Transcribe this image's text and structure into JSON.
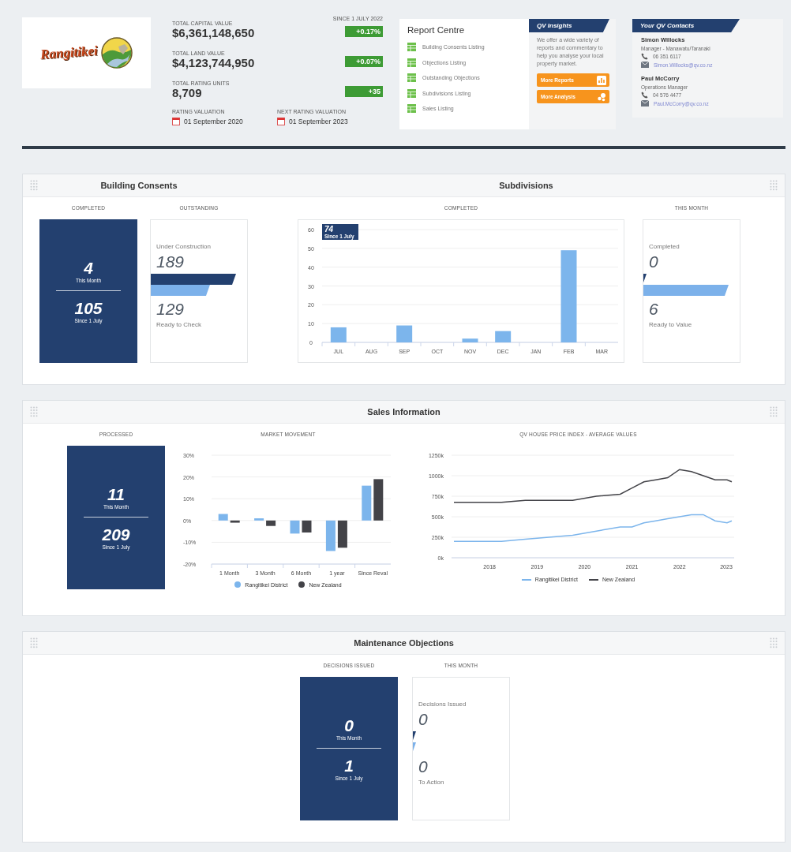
{
  "header": {
    "logo": {
      "text": "Rangitikei"
    },
    "change_period": "SINCE 1 JULY 2022",
    "stats": [
      {
        "label": "TOTAL CAPITAL VALUE",
        "value": "$6,361,148,650",
        "change": "+0.17%"
      },
      {
        "label": "TOTAL LAND VALUE",
        "value": "$4,123,744,950",
        "change": "+0.07%"
      },
      {
        "label": "TOTAL RATING UNITS",
        "value": "8,709",
        "change": "+35"
      }
    ],
    "dates": [
      {
        "label": "RATING VALUATION",
        "value": "01 September 2020"
      },
      {
        "label": "NEXT RATING VALUATION",
        "value": "01 September 2023"
      }
    ]
  },
  "report_centre": {
    "title": "Report Centre",
    "items": [
      "Building Consents Listing",
      "Objections Listing",
      "Outstanding Objections",
      "Subdivisions Listing",
      "Sales Listing"
    ]
  },
  "insights": {
    "title": "QV Insights",
    "text": "We offer a wide variety of reports and commentary to help you analyse your local property market.",
    "buttons": [
      {
        "label": "More Reports",
        "kind": "reports"
      },
      {
        "label": "More Analysis",
        "kind": "analysis"
      }
    ]
  },
  "contacts": {
    "title": "Your QV Contacts",
    "people": [
      {
        "name": "Simon Willocks",
        "role": "Manager - Manawatu/Taranaki",
        "phone": "06 351 6117",
        "email": "Simon.Willocks@qv.co.nz"
      },
      {
        "name": "Paul McCorry",
        "role": "Operations Manager",
        "phone": "04 576 4477",
        "email": "Paul.McCorry@qv.co.nz"
      }
    ]
  },
  "building": {
    "titles": [
      "Building Consents",
      "Subdivisions"
    ],
    "completed": {
      "label": "COMPLETED",
      "month_value": "4",
      "month_label": "This Month",
      "since_value": "105",
      "since_label": "Since 1 July"
    },
    "outstanding": {
      "label": "OUTSTANDING",
      "top": {
        "label": "Under Construction",
        "value": "189"
      },
      "bottom": {
        "label": "Ready to Check",
        "value": "129"
      }
    },
    "subdivisions": {
      "label": "COMPLETED",
      "badge_value": "74",
      "badge_label": "Since 1 July",
      "chart_data": {
        "type": "bar",
        "categories": [
          "JUL",
          "AUG",
          "SEP",
          "OCT",
          "NOV",
          "DEC",
          "JAN",
          "FEB",
          "MAR"
        ],
        "series": [
          {
            "color": "#7cb5ec",
            "values": [
              8,
              0,
              9,
              0,
              2,
              6,
              0,
              49,
              0
            ]
          }
        ],
        "ylim": [
          0,
          60
        ],
        "yticks": [
          0,
          10,
          20,
          30,
          40,
          50,
          60
        ],
        "grid": true
      }
    },
    "this_month": {
      "label": "THIS MONTH",
      "top": {
        "label": "Completed",
        "value": "0"
      },
      "bottom": {
        "label": "Ready to Value",
        "value": "6"
      }
    }
  },
  "sales": {
    "title": "Sales Information",
    "processed": {
      "label": "PROCESSED",
      "month_value": "11",
      "month_label": "This Month",
      "since_value": "209",
      "since_label": "Since 1 July"
    },
    "market": {
      "chart_data": {
        "type": "bar",
        "title": "MARKET MOVEMENT",
        "categories": [
          "1 Month",
          "3 Month",
          "6 Month",
          "1 year",
          "Since Reval"
        ],
        "series": [
          {
            "name": "Rangitikei District",
            "color": "#7cb5ec",
            "values": [
              3,
              1,
              -6,
              -14,
              16
            ]
          },
          {
            "name": "New Zealand",
            "color": "#434348",
            "values": [
              -1,
              -2.5,
              -5.5,
              -12.5,
              19
            ]
          }
        ],
        "ylim": [
          -20,
          30
        ],
        "yticks": [
          {
            "value": -20,
            "label": "-20%"
          },
          {
            "value": -10,
            "label": "-10%"
          },
          {
            "value": 0,
            "label": "0%"
          },
          {
            "value": 10,
            "label": "10%"
          },
          {
            "value": 20,
            "label": "20%"
          },
          {
            "value": 30,
            "label": "30%"
          }
        ],
        "grid": true,
        "legend": "bottom"
      }
    },
    "index": {
      "chart_data": {
        "type": "line",
        "title": "QV HOUSE PRICE INDEX - AVERAGE VALUES",
        "x": [
          2017.25,
          2017.75,
          2018.25,
          2018.75,
          2019.25,
          2019.75,
          2020.25,
          2020.75,
          2021.0,
          2021.25,
          2021.5,
          2021.75,
          2022.0,
          2022.25,
          2022.5,
          2022.75,
          2023.0,
          2023.1
        ],
        "series": [
          {
            "name": "Rangitikei District",
            "color": "#7cb5ec",
            "values": [
              200,
              200,
              200,
              225,
              250,
              275,
              325,
              375,
              375,
              425,
              450,
              475,
              500,
              525,
              525,
              450,
              425,
              450
            ]
          },
          {
            "name": "New Zealand",
            "color": "#434348",
            "values": [
              675,
              675,
              675,
              700,
              700,
              700,
              750,
              775,
              850,
              925,
              950,
              975,
              1075,
              1050,
              1000,
              950,
              950,
              925
            ]
          }
        ],
        "xlim": [
          2017.2,
          2023.15
        ],
        "ylim": [
          0,
          1250
        ],
        "xticks": [
          2018,
          2019,
          2020,
          2021,
          2022,
          2023
        ],
        "yticks": [
          {
            "value": 0,
            "label": "0k"
          },
          {
            "value": 250,
            "label": "250k"
          },
          {
            "value": 500,
            "label": "500k"
          },
          {
            "value": 750,
            "label": "750k"
          },
          {
            "value": 1000,
            "label": "1000k"
          },
          {
            "value": 1250,
            "label": "1250k"
          }
        ],
        "grid": true,
        "legend": "bottom"
      }
    }
  },
  "objections": {
    "title": "Maintenance Objections",
    "decisions": {
      "label": "DECISIONS ISSUED",
      "month_value": "0",
      "month_label": "This Month",
      "since_value": "1",
      "since_label": "Since 1 July"
    },
    "this_month": {
      "label": "THIS MONTH",
      "top": {
        "label": "Decisions Issued",
        "value": "0"
      },
      "bottom": {
        "label": "To Action",
        "value": "0"
      }
    }
  }
}
